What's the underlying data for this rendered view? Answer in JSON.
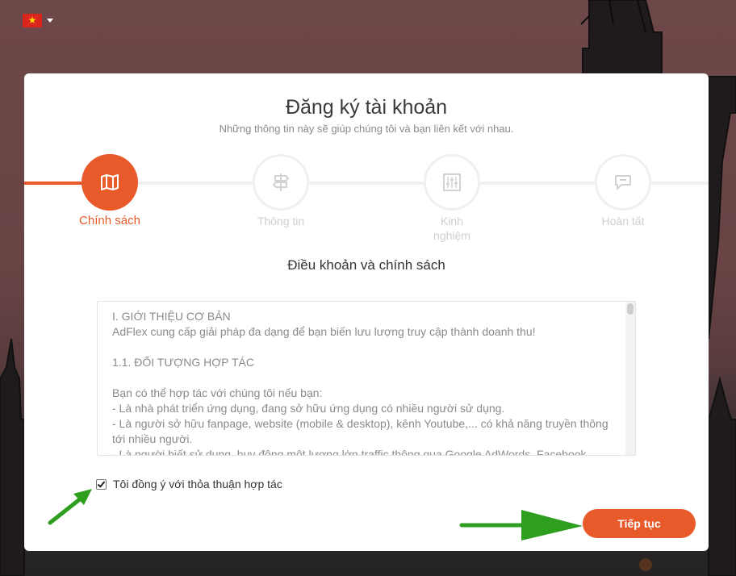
{
  "language": {
    "flag": "vietnam-flag-icon"
  },
  "header": {
    "title": "Đăng ký tài khoản",
    "subtitle": "Những thông tin này sẽ giúp chúng tôi và bạn liên kết với nhau."
  },
  "steps": [
    {
      "label": "Chính sách",
      "icon": "map-icon",
      "active": true
    },
    {
      "label": "Thông tin",
      "icon": "signpost-icon",
      "active": false
    },
    {
      "label": "Kinh\nnghiệm",
      "icon": "sliders-icon",
      "active": false
    },
    {
      "label": "Hoàn tất",
      "icon": "chat-icon",
      "active": false
    }
  ],
  "section": {
    "heading": "Điều khoản và chính sách"
  },
  "terms": {
    "text": "I. GIỚI THIỆU CƠ BẢN\nAdFlex cung cấp giải pháp đa dạng để bạn biến lưu lượng truy cập thành doanh thu!\n\n1.1. ĐỐI TƯỢNG HỢP TÁC\n\nBạn có thể hợp tác với chúng tôi nếu bạn:\n- Là nhà phát triển ứng dụng, đang sở hữu ứng dụng có nhiều người sử dụng.\n- Là người sở hữu fanpage, website (mobile & desktop), kênh Youtube,... có khả năng truyền thông tới nhiều người.\n- Là người biết sử dụng, huy động một lượng lớn traffic thông qua Google AdWords, Facebook"
  },
  "agreement": {
    "label": "Tôi đồng ý với thỏa thuận hợp tác",
    "checked": true
  },
  "actions": {
    "continue_label": "Tiếp tục"
  },
  "colors": {
    "accent": "#e85a2a",
    "arrow": "#2e9e1f"
  }
}
